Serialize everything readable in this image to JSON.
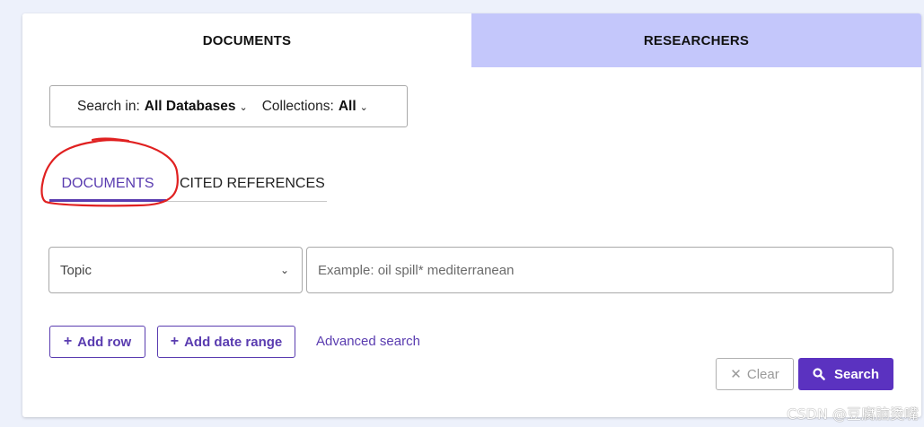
{
  "main_tabs": [
    {
      "label": "DOCUMENTS",
      "active": true
    },
    {
      "label": "RESEARCHERS",
      "active": false
    }
  ],
  "database_selector": {
    "search_in_label": "Search in:",
    "search_in_value": "All Databases",
    "collections_label": "Collections:",
    "collections_value": "All"
  },
  "sub_tabs": [
    {
      "label": "DOCUMENTS",
      "active": true
    },
    {
      "label": "CITED REFERENCES",
      "active": false
    }
  ],
  "search_row": {
    "field_value": "Topic",
    "query_value": "",
    "query_placeholder": "Example: oil spill* mediterranean"
  },
  "actions": {
    "add_row_label": "Add row",
    "add_date_range_label": "Add date range",
    "advanced_search_label": "Advanced search",
    "clear_label": "Clear",
    "search_label": "Search"
  },
  "icons": {
    "chevron": "chevron-down-icon",
    "plus": "plus-icon",
    "clear": "close-icon",
    "search": "search-icon"
  },
  "colors": {
    "accent": "#5b32c0",
    "inactive_tab_bg": "#c4c7fb",
    "page_bg": "#edf1fb",
    "annotation_stroke": "#e02020"
  },
  "watermark": "CSDN @豆腐脑烫嘴"
}
